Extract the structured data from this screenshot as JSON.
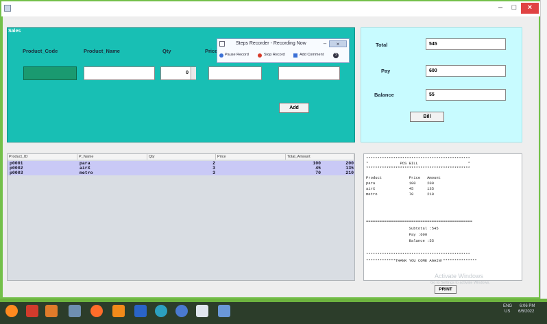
{
  "window": {
    "minimize": "–",
    "maximize": "□",
    "close": "×"
  },
  "sales": {
    "title": "Sales",
    "columns": [
      "Product_Code",
      "Product_Name",
      "Qty",
      "Price"
    ],
    "qty_value": "0",
    "add_label": "Add"
  },
  "steps_recorder": {
    "title": "Steps Recorder - Recording Now",
    "pause": "Pause Record",
    "stop": "Stop Record",
    "comment": "Add Comment",
    "help": "?"
  },
  "totals": {
    "total_label": "Total",
    "total_value": "545",
    "pay_label": "Pay",
    "pay_value": "600",
    "balance_label": "Balance",
    "balance_value": "55",
    "bill_label": "Bill"
  },
  "table": {
    "headers": [
      "Product_ID",
      "P_Name",
      "Qty",
      "Price",
      "Total_Amount"
    ],
    "rows": [
      {
        "id": "p0001",
        "name": "para",
        "qty": "2",
        "price": "100",
        "total": "200"
      },
      {
        "id": "p0002",
        "name": "airX",
        "qty": "3",
        "price": "45",
        "total": "135"
      },
      {
        "id": "p0003",
        "name": "metro",
        "qty": "3",
        "price": "70",
        "total": "210"
      }
    ]
  },
  "receipt": {
    "lines": [
      "**********************************************",
      "*              POS BILL                      *",
      "**********************************************",
      "Product            Price   Amount",
      "para               100     200",
      "airX               45      135",
      "metro              70      210",
      "",
      "",
      "===============================================",
      "                   Subtotal :545",
      "                   Pay :600",
      "                   Balance :55",
      "",
      "**********************************************",
      "*************THANK YOU COME AGAIN!***************"
    ],
    "print_label": "PRINT"
  },
  "watermark": {
    "title": "Activate Windows",
    "subtitle": "Go to Settings to activate Windows."
  },
  "taskbar": {
    "lang": "ENG",
    "region": "US",
    "time": "6:06 PM",
    "date": "6/6/2022"
  },
  "colors": {
    "sales_panel": "#18bfb4",
    "totals_panel": "#c8fbff",
    "row_highlight": "#c9c9f6"
  }
}
